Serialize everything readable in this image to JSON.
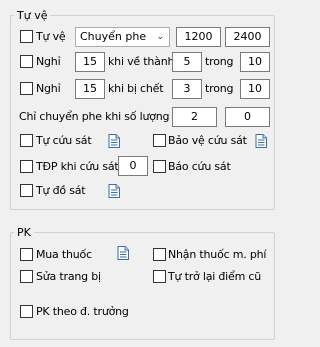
{
  "tu_ve": {
    "title": "Tự vệ",
    "tu_ve_label": "Tự vệ",
    "skill_select": "Chuyển phe",
    "value_a": "1200",
    "value_b": "2400",
    "nghi1_label": "Nghỉ",
    "nghi1_value": "15",
    "nghi1_text": "khi về thành",
    "nghi1_count": "5",
    "nghi1_trong": "trong",
    "nghi1_total": "10",
    "nghi2_label": "Nghỉ",
    "nghi2_value": "15",
    "nghi2_text": "khi bị chết",
    "nghi2_count": "3",
    "nghi2_trong": "trong",
    "nghi2_total": "10",
    "chi_chuyen_label": "Chỉ chuyển phe khi số lượng",
    "chi_chuyen_a": "2",
    "chi_chuyen_b": "0",
    "tu_cuu_sat": "Tự cứu sát",
    "bao_ve_cuu_sat": "Bảo vệ cứu sát",
    "tdp_khi_cuu_sat": "TĐP khi cứu sát",
    "tdp_value": "0",
    "bao_cuu_sat": "Báo cứu sát",
    "tu_do_sat": "Tự đồ sát"
  },
  "pk": {
    "title": "PK",
    "mua_thuoc": "Mua thuốc",
    "nhan_thuoc": "Nhận thuốc m. phí",
    "sua_trang_bi": "Sửa trang bị",
    "tu_tro_lai": "Tự trở lại điểm cũ",
    "pk_theo": "PK theo đ. trưởng"
  }
}
